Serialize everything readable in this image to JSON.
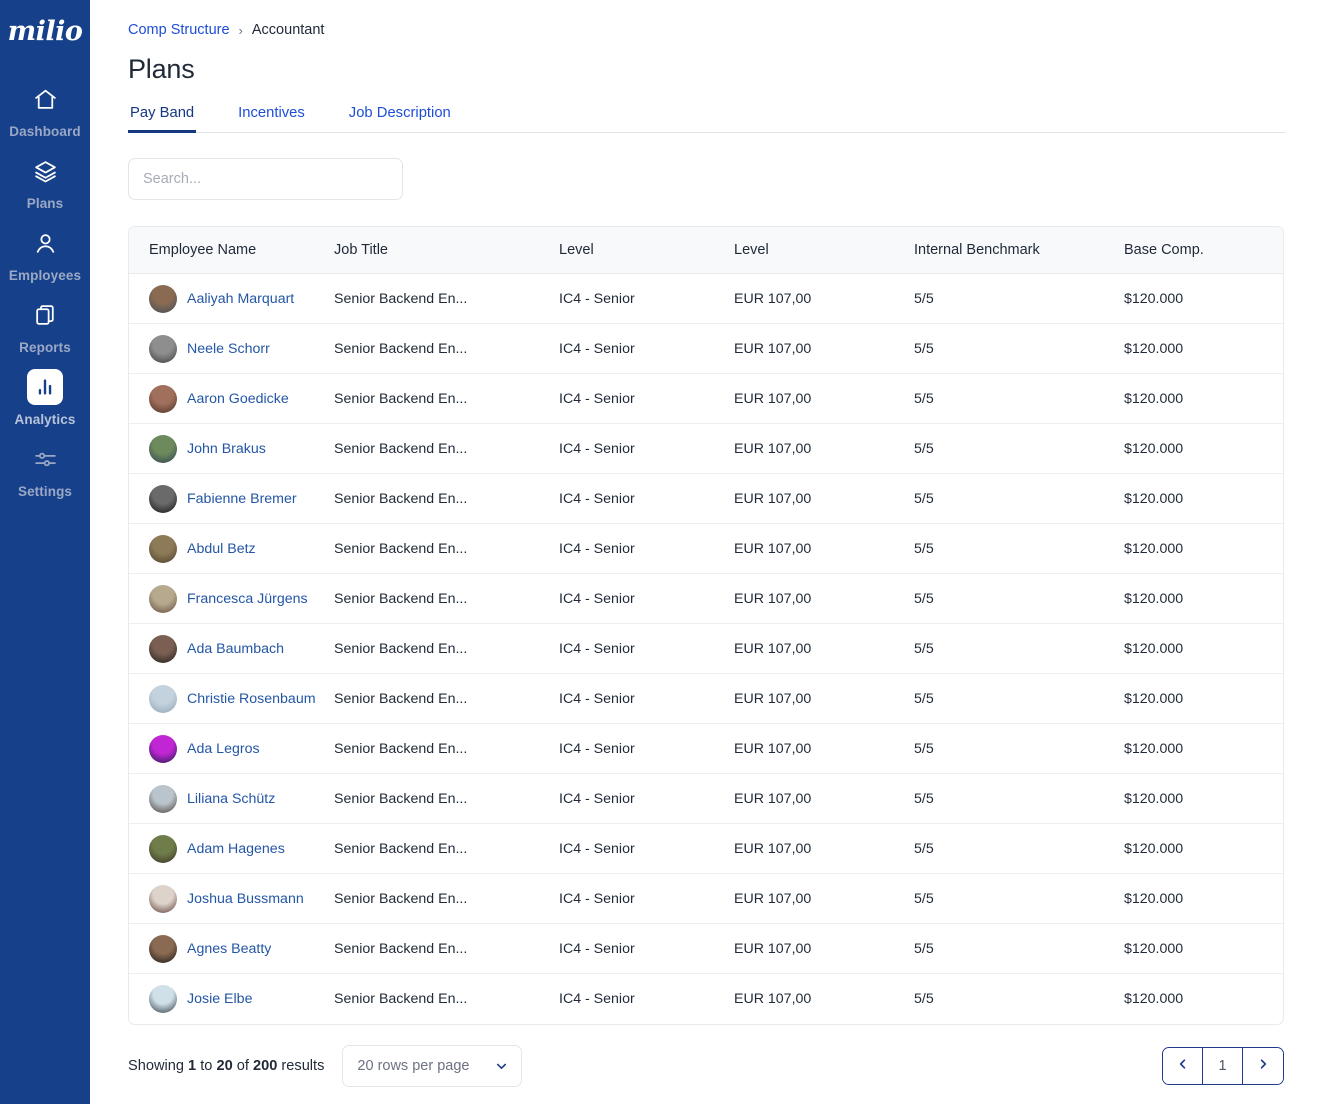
{
  "brand": {
    "logo_text": "milio",
    "sidebar_color": "#17408B",
    "accent_color": "#1D4ED8"
  },
  "sidebar": {
    "items": [
      {
        "label": "Dashboard",
        "icon": "home-icon",
        "active": false
      },
      {
        "label": "Plans",
        "icon": "layers-icon",
        "active": false
      },
      {
        "label": "Employees",
        "icon": "user-icon",
        "active": false
      },
      {
        "label": "Reports",
        "icon": "documents-icon",
        "active": false
      },
      {
        "label": "Analytics",
        "icon": "bar-chart-icon",
        "active": true
      },
      {
        "label": "Settings",
        "icon": "sliders-icon",
        "active": false
      }
    ]
  },
  "breadcrumb": {
    "parent": "Comp Structure",
    "separator": "›",
    "current": "Accountant"
  },
  "page": {
    "title": "Plans"
  },
  "tabs": [
    {
      "label": "Pay Band",
      "active": true
    },
    {
      "label": "Incentives",
      "active": false
    },
    {
      "label": "Job Description",
      "active": false
    }
  ],
  "search": {
    "placeholder": "Search...",
    "value": ""
  },
  "table": {
    "columns": [
      "Employee Name",
      "Job Title",
      "Level",
      "Level",
      "Internal Benchmark",
      "Base Comp."
    ],
    "rows": [
      {
        "name": "Aaliyah Marquart",
        "job_title": "Senior Backend En...",
        "level": "IC4 - Senior",
        "level2": "EUR 107,00",
        "benchmark": "5/5",
        "base_comp": "$120.000",
        "avatar_color_a": "#8a6b52",
        "avatar_color_b": "#3c4a5a"
      },
      {
        "name": "Neele Schorr",
        "job_title": "Senior Backend En...",
        "level": "IC4 - Senior",
        "level2": "EUR 107,00",
        "benchmark": "5/5",
        "base_comp": "$120.000",
        "avatar_color_a": "#8e8e8e",
        "avatar_color_b": "#3a3a3a"
      },
      {
        "name": "Aaron Goedicke",
        "job_title": "Senior Backend En...",
        "level": "IC4 - Senior",
        "level2": "EUR 107,00",
        "benchmark": "5/5",
        "base_comp": "$120.000",
        "avatar_color_a": "#a0705c",
        "avatar_color_b": "#4a2f28"
      },
      {
        "name": "John Brakus",
        "job_title": "Senior Backend En...",
        "level": "IC4 - Senior",
        "level2": "EUR 107,00",
        "benchmark": "5/5",
        "base_comp": "$120.000",
        "avatar_color_a": "#6d8a5c",
        "avatar_color_b": "#2d3e50"
      },
      {
        "name": "Fabienne Bremer",
        "job_title": "Senior Backend En...",
        "level": "IC4 - Senior",
        "level2": "EUR 107,00",
        "benchmark": "5/5",
        "base_comp": "$120.000",
        "avatar_color_a": "#6a6a6a",
        "avatar_color_b": "#111111"
      },
      {
        "name": "Abdul Betz",
        "job_title": "Senior Backend En...",
        "level": "IC4 - Senior",
        "level2": "EUR 107,00",
        "benchmark": "5/5",
        "base_comp": "$120.000",
        "avatar_color_a": "#8d7a56",
        "avatar_color_b": "#4a3c2a"
      },
      {
        "name": "Francesca Jürgens",
        "job_title": "Senior Backend En...",
        "level": "IC4 - Senior",
        "level2": "EUR 107,00",
        "benchmark": "5/5",
        "base_comp": "$120.000",
        "avatar_color_a": "#b7a98e",
        "avatar_color_b": "#5f4a3a"
      },
      {
        "name": "Ada Baumbach",
        "job_title": "Senior Backend En...",
        "level": "IC4 - Senior",
        "level2": "EUR 107,00",
        "benchmark": "5/5",
        "base_comp": "$120.000",
        "avatar_color_a": "#7a5f52",
        "avatar_color_b": "#1a1a1a"
      },
      {
        "name": "Christie Rosenbaum",
        "job_title": "Senior Backend En...",
        "level": "IC4 - Senior",
        "level2": "EUR 107,00",
        "benchmark": "5/5",
        "base_comp": "$120.000",
        "avatar_color_a": "#c3d2dd",
        "avatar_color_b": "#8fa3b5"
      },
      {
        "name": "Ada Legros",
        "job_title": "Senior Backend En...",
        "level": "IC4 - Senior",
        "level2": "EUR 107,00",
        "benchmark": "5/5",
        "base_comp": "$120.000",
        "avatar_color_a": "#c026d3",
        "avatar_color_b": "#1e1b4b"
      },
      {
        "name": "Liliana Schütz",
        "job_title": "Senior Backend En...",
        "level": "IC4 - Senior",
        "level2": "EUR 107,00",
        "benchmark": "5/5",
        "base_comp": "$120.000",
        "avatar_color_a": "#b9c4cc",
        "avatar_color_b": "#4a3b32"
      },
      {
        "name": "Adam Hagenes",
        "job_title": "Senior Backend En...",
        "level": "IC4 - Senior",
        "level2": "EUR 107,00",
        "benchmark": "5/5",
        "base_comp": "$120.000",
        "avatar_color_a": "#6f7d4a",
        "avatar_color_b": "#3a2e22"
      },
      {
        "name": "Joshua Bussmann",
        "job_title": "Senior Backend En...",
        "level": "IC4 - Senior",
        "level2": "EUR 107,00",
        "benchmark": "5/5",
        "base_comp": "$120.000",
        "avatar_color_a": "#ded3cb",
        "avatar_color_b": "#5a3a32"
      },
      {
        "name": "Agnes Beatty",
        "job_title": "Senior Backend En...",
        "level": "IC4 - Senior",
        "level2": "EUR 107,00",
        "benchmark": "5/5",
        "base_comp": "$120.000",
        "avatar_color_a": "#8a6a52",
        "avatar_color_b": "#151515"
      },
      {
        "name": "Josie Elbe",
        "job_title": "Senior Backend En...",
        "level": "IC4 - Senior",
        "level2": "EUR 107,00",
        "benchmark": "5/5",
        "base_comp": "$120.000",
        "avatar_color_a": "#cfe0e8",
        "avatar_color_b": "#2a3540"
      }
    ]
  },
  "footer": {
    "showing_prefix": "Showing",
    "from": "1",
    "to_word": "to",
    "to": "20",
    "of_word": "of",
    "total": "200",
    "results_word": "results",
    "rows_per_page_selected": "20 rows per page",
    "rows_per_page_options": [
      "20 rows per page"
    ],
    "prev_label": "‹",
    "page_label": "1",
    "next_label": "›"
  }
}
